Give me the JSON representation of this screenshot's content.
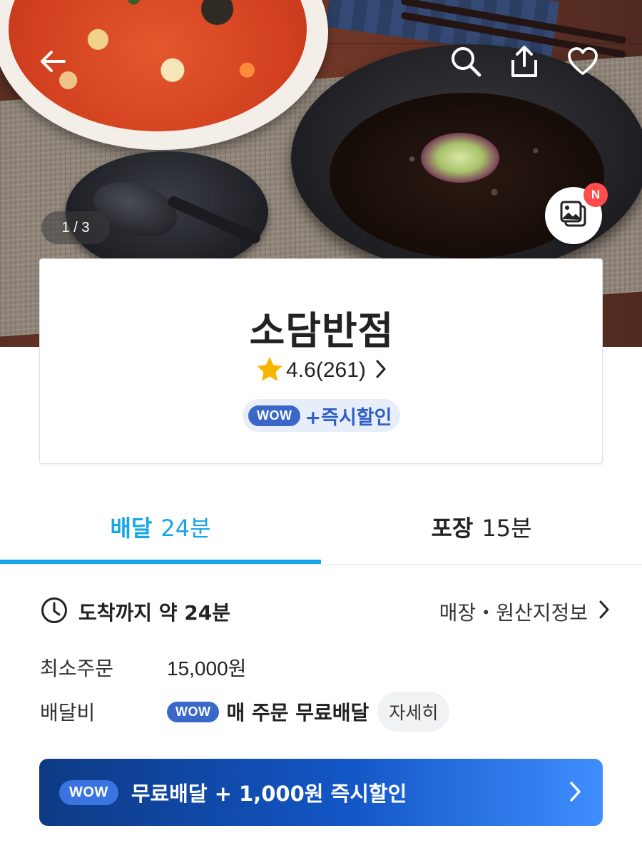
{
  "hero": {
    "photo_counter": "1 / 3",
    "new_badge": "N",
    "icons": [
      "back-arrow-icon",
      "search-icon",
      "share-icon",
      "heart-icon",
      "photo-gallery-icon"
    ]
  },
  "store": {
    "name": "소담반점",
    "rating": "4.6(261)",
    "wow_badge": "WOW",
    "wow_promo": "+즉시할인"
  },
  "tabs": [
    {
      "name": "배달",
      "time": "24분",
      "active": true
    },
    {
      "name": "포장",
      "time": "15분",
      "active": false
    }
  ],
  "info": {
    "eta": "도착까지 약 24분",
    "store_info_link": "매장・원산지정보",
    "min_order_label": "최소주문",
    "min_order_value": "15,000원",
    "delivery_fee_label": "배달비",
    "delivery_fee_badge": "WOW",
    "delivery_fee_text": "매 주문 무료배달",
    "detail_button": "자세히"
  },
  "banner": {
    "badge": "WOW",
    "text": "무료배달 + 1,000원 즉시할인"
  },
  "colors": {
    "accent_blue": "#19a6e8",
    "wow_blue": "#3a68c9",
    "new_badge_red": "#ff4d4d",
    "star_yellow": "#f7b500"
  }
}
